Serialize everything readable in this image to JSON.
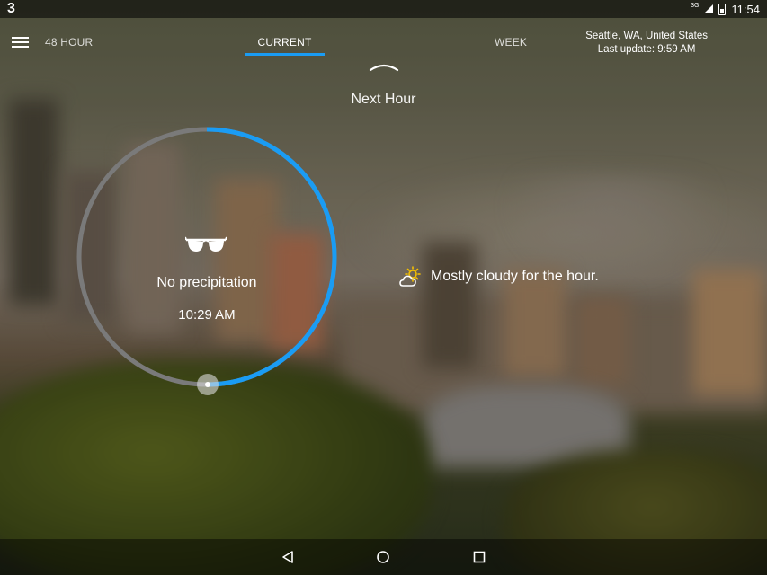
{
  "status_bar": {
    "notification_count": "3",
    "network": "3G",
    "time": "11:54"
  },
  "tabs": {
    "hour48": "48 HOUR",
    "current": "CURRENT",
    "week": "WEEK",
    "active": "CURRENT"
  },
  "location": {
    "name": "Seattle, WA, United States",
    "last_update": "Last update: 9:59 AM"
  },
  "next_hour_label": "Next Hour",
  "precipitation": {
    "label": "No precipitation",
    "time": "10:29 AM",
    "icon": "sunglasses-icon",
    "progress_fraction": 0.5
  },
  "summary": {
    "icon": "partly-cloudy-icon",
    "text": "Mostly cloudy for the hour."
  },
  "colors": {
    "accent": "#1a9cf4",
    "ring_track": "#7a7a7a",
    "sun": "#f5c000"
  }
}
